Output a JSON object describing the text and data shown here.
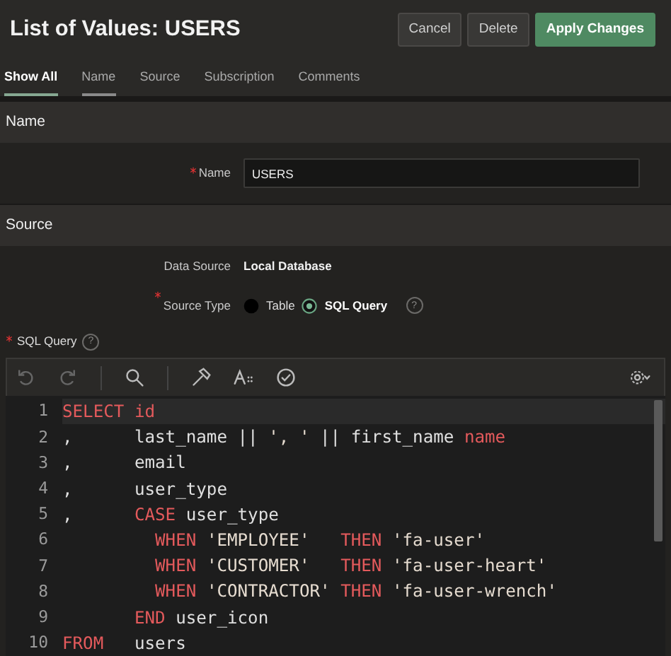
{
  "header": {
    "title": "List of Values: USERS",
    "buttons": [
      {
        "label": "Cancel",
        "kind": "default"
      },
      {
        "label": "Delete",
        "kind": "default"
      },
      {
        "label": "Apply Changes",
        "kind": "primary"
      }
    ]
  },
  "tabs": [
    {
      "label": "Show All",
      "selected": true,
      "hovered": false
    },
    {
      "label": "Name",
      "selected": false,
      "hovered": true
    },
    {
      "label": "Source",
      "selected": false,
      "hovered": false
    },
    {
      "label": "Subscription",
      "selected": false,
      "hovered": false
    },
    {
      "label": "Comments",
      "selected": false,
      "hovered": false
    }
  ],
  "name_section": {
    "title": "Name",
    "field": {
      "label": "Name",
      "required": true,
      "value": "USERS"
    }
  },
  "source_section": {
    "title": "Source",
    "data_source": {
      "label": "Data Source",
      "value": "Local Database"
    },
    "source_type": {
      "label": "Source Type",
      "required": true,
      "help": "?",
      "options": [
        {
          "label": "Table",
          "selected": false
        },
        {
          "label": "SQL Query",
          "selected": true
        }
      ]
    },
    "sql_query": {
      "label": "SQL Query",
      "required": true,
      "help": "?"
    }
  },
  "editor": {
    "lines": [
      {
        "number": "1",
        "active": true,
        "tokens": [
          {
            "kind": "keyword",
            "text": "SELECT id"
          }
        ]
      },
      {
        "number": "2",
        "active": false,
        "tokens": [
          {
            "kind": "plain",
            "text": ",      last_name || "
          },
          {
            "kind": "string",
            "text": "', '"
          },
          {
            "kind": "plain",
            "text": " || first_name "
          },
          {
            "kind": "keyword",
            "text": "name"
          }
        ]
      },
      {
        "number": "3",
        "active": false,
        "tokens": [
          {
            "kind": "plain",
            "text": ",      email"
          }
        ]
      },
      {
        "number": "4",
        "active": false,
        "tokens": [
          {
            "kind": "plain",
            "text": ",      user_type"
          }
        ]
      },
      {
        "number": "5",
        "active": false,
        "tokens": [
          {
            "kind": "plain",
            "text": ",      "
          },
          {
            "kind": "keyword",
            "text": "CASE"
          },
          {
            "kind": "plain",
            "text": " user_type"
          }
        ]
      },
      {
        "number": "6",
        "active": false,
        "tokens": [
          {
            "kind": "keyword",
            "text": "         WHEN "
          },
          {
            "kind": "string",
            "text": "'EMPLOYEE'   "
          },
          {
            "kind": "keyword",
            "text": "THEN "
          },
          {
            "kind": "string",
            "text": "'fa-user'"
          }
        ]
      },
      {
        "number": "7",
        "active": false,
        "tokens": [
          {
            "kind": "keyword",
            "text": "         WHEN "
          },
          {
            "kind": "string",
            "text": "'CUSTOMER'   "
          },
          {
            "kind": "keyword",
            "text": "THEN "
          },
          {
            "kind": "string",
            "text": "'fa-user-heart'"
          }
        ]
      },
      {
        "number": "8",
        "active": false,
        "tokens": [
          {
            "kind": "keyword",
            "text": "         WHEN "
          },
          {
            "kind": "string",
            "text": "'CONTRACTOR' "
          },
          {
            "kind": "keyword",
            "text": "THEN "
          },
          {
            "kind": "string",
            "text": "'fa-user-wrench'"
          }
        ]
      },
      {
        "number": "9",
        "active": false,
        "tokens": [
          {
            "kind": "keyword",
            "text": "       END"
          },
          {
            "kind": "plain",
            "text": " user_icon"
          }
        ]
      },
      {
        "number": "10",
        "active": false,
        "tokens": [
          {
            "kind": "keyword",
            "text": "FROM"
          },
          {
            "kind": "plain",
            "text": "   users"
          }
        ]
      }
    ]
  }
}
